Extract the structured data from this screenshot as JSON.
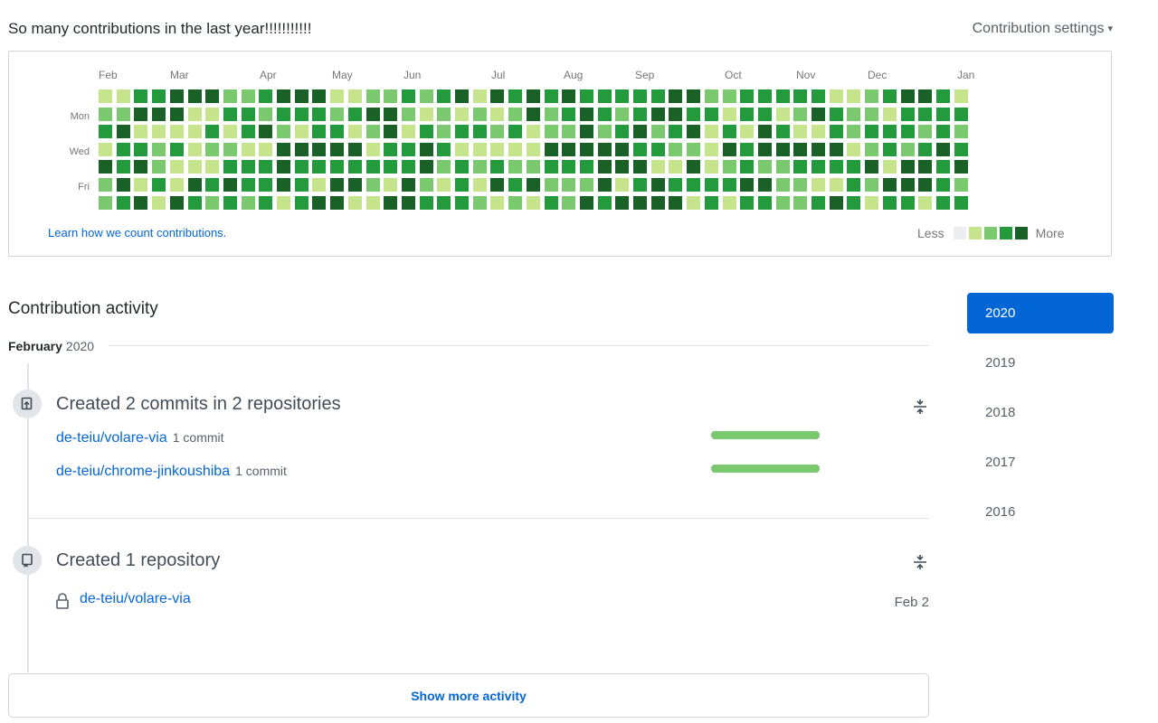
{
  "header": {
    "title": "So many contributions in the last year!!!!!!!!!!!",
    "settings_label": "Contribution settings"
  },
  "calendar": {
    "months": [
      "Feb",
      "Mar",
      "Apr",
      "May",
      "Jun",
      "Jul",
      "Aug",
      "Sep",
      "Oct",
      "Nov",
      "Dec",
      "Jan"
    ],
    "day_labels": [
      "Mon",
      "Wed",
      "Fri"
    ],
    "learn_link": "Learn how we count contributions.",
    "legend_less": "Less",
    "legend_more": "More",
    "colors": [
      "#ebedf0",
      "#c6e48b",
      "#7bc96f",
      "#239a3b",
      "#196127"
    ],
    "weeks": [
      [
        1,
        2,
        3,
        1,
        4,
        2,
        2
      ],
      [
        1,
        2,
        4,
        3,
        3,
        4,
        3
      ],
      [
        3,
        4,
        1,
        3,
        4,
        1,
        4
      ],
      [
        3,
        4,
        1,
        2,
        2,
        3,
        1
      ],
      [
        4,
        4,
        1,
        3,
        1,
        1,
        4
      ],
      [
        4,
        1,
        1,
        1,
        1,
        4,
        3
      ],
      [
        4,
        1,
        3,
        2,
        1,
        3,
        2
      ],
      [
        2,
        3,
        1,
        2,
        3,
        4,
        3
      ],
      [
        2,
        3,
        3,
        1,
        3,
        3,
        2
      ],
      [
        3,
        2,
        4,
        1,
        3,
        3,
        3
      ],
      [
        4,
        3,
        2,
        4,
        4,
        4,
        1
      ],
      [
        4,
        3,
        1,
        4,
        3,
        3,
        3
      ],
      [
        4,
        3,
        3,
        4,
        3,
        1,
        4
      ],
      [
        1,
        2,
        3,
        4,
        3,
        4,
        4
      ],
      [
        1,
        3,
        1,
        4,
        3,
        4,
        1
      ],
      [
        2,
        4,
        2,
        1,
        3,
        2,
        1
      ],
      [
        2,
        4,
        4,
        3,
        3,
        1,
        4
      ],
      [
        3,
        2,
        1,
        3,
        3,
        4,
        4
      ],
      [
        2,
        1,
        3,
        4,
        4,
        2,
        3
      ],
      [
        3,
        2,
        2,
        3,
        2,
        1,
        3
      ],
      [
        4,
        1,
        3,
        1,
        3,
        3,
        3
      ],
      [
        1,
        2,
        3,
        1,
        2,
        1,
        2
      ],
      [
        4,
        1,
        2,
        1,
        3,
        4,
        1
      ],
      [
        3,
        2,
        3,
        1,
        2,
        3,
        2
      ],
      [
        4,
        4,
        1,
        1,
        2,
        4,
        1
      ],
      [
        3,
        2,
        2,
        4,
        3,
        2,
        3
      ],
      [
        4,
        3,
        2,
        4,
        3,
        2,
        2
      ],
      [
        3,
        4,
        4,
        4,
        3,
        2,
        4
      ],
      [
        3,
        3,
        2,
        4,
        4,
        4,
        3
      ],
      [
        3,
        2,
        3,
        4,
        4,
        1,
        4
      ],
      [
        3,
        3,
        4,
        3,
        4,
        3,
        4
      ],
      [
        3,
        4,
        2,
        3,
        1,
        4,
        4
      ],
      [
        4,
        4,
        3,
        2,
        1,
        3,
        4
      ],
      [
        4,
        3,
        4,
        2,
        4,
        3,
        1
      ],
      [
        2,
        3,
        1,
        1,
        1,
        3,
        3
      ],
      [
        2,
        1,
        3,
        4,
        2,
        3,
        1
      ],
      [
        3,
        3,
        1,
        3,
        3,
        4,
        3
      ],
      [
        3,
        3,
        4,
        4,
        2,
        4,
        3
      ],
      [
        3,
        1,
        3,
        4,
        2,
        2,
        2
      ],
      [
        3,
        2,
        1,
        4,
        3,
        2,
        2
      ],
      [
        3,
        4,
        1,
        4,
        3,
        1,
        3
      ],
      [
        1,
        3,
        3,
        4,
        3,
        1,
        4
      ],
      [
        1,
        2,
        2,
        1,
        3,
        3,
        3
      ],
      [
        2,
        2,
        3,
        2,
        4,
        2,
        1
      ],
      [
        3,
        1,
        3,
        3,
        1,
        4,
        3
      ],
      [
        4,
        3,
        3,
        2,
        4,
        4,
        3
      ],
      [
        4,
        3,
        2,
        3,
        4,
        4,
        1
      ],
      [
        3,
        3,
        3,
        4,
        3,
        3,
        3
      ],
      [
        1,
        3,
        2,
        3,
        4,
        2,
        3
      ]
    ]
  },
  "activity": {
    "title": "Contribution activity",
    "month": "February",
    "year": "2020",
    "event1": {
      "title": "Created 2 commits in 2 repositories",
      "repos": [
        {
          "name": "de-teiu/volare-via",
          "count": "1 commit",
          "share": 1.0
        },
        {
          "name": "de-teiu/chrome-jinkoushiba",
          "count": "1 commit",
          "share": 1.0
        }
      ]
    },
    "event2": {
      "title": "Created 1 repository",
      "repo": "de-teiu/volare-via",
      "date": "Feb 2"
    },
    "show_more": "Show more activity"
  },
  "years": [
    "2020",
    "2019",
    "2018",
    "2017",
    "2016"
  ]
}
